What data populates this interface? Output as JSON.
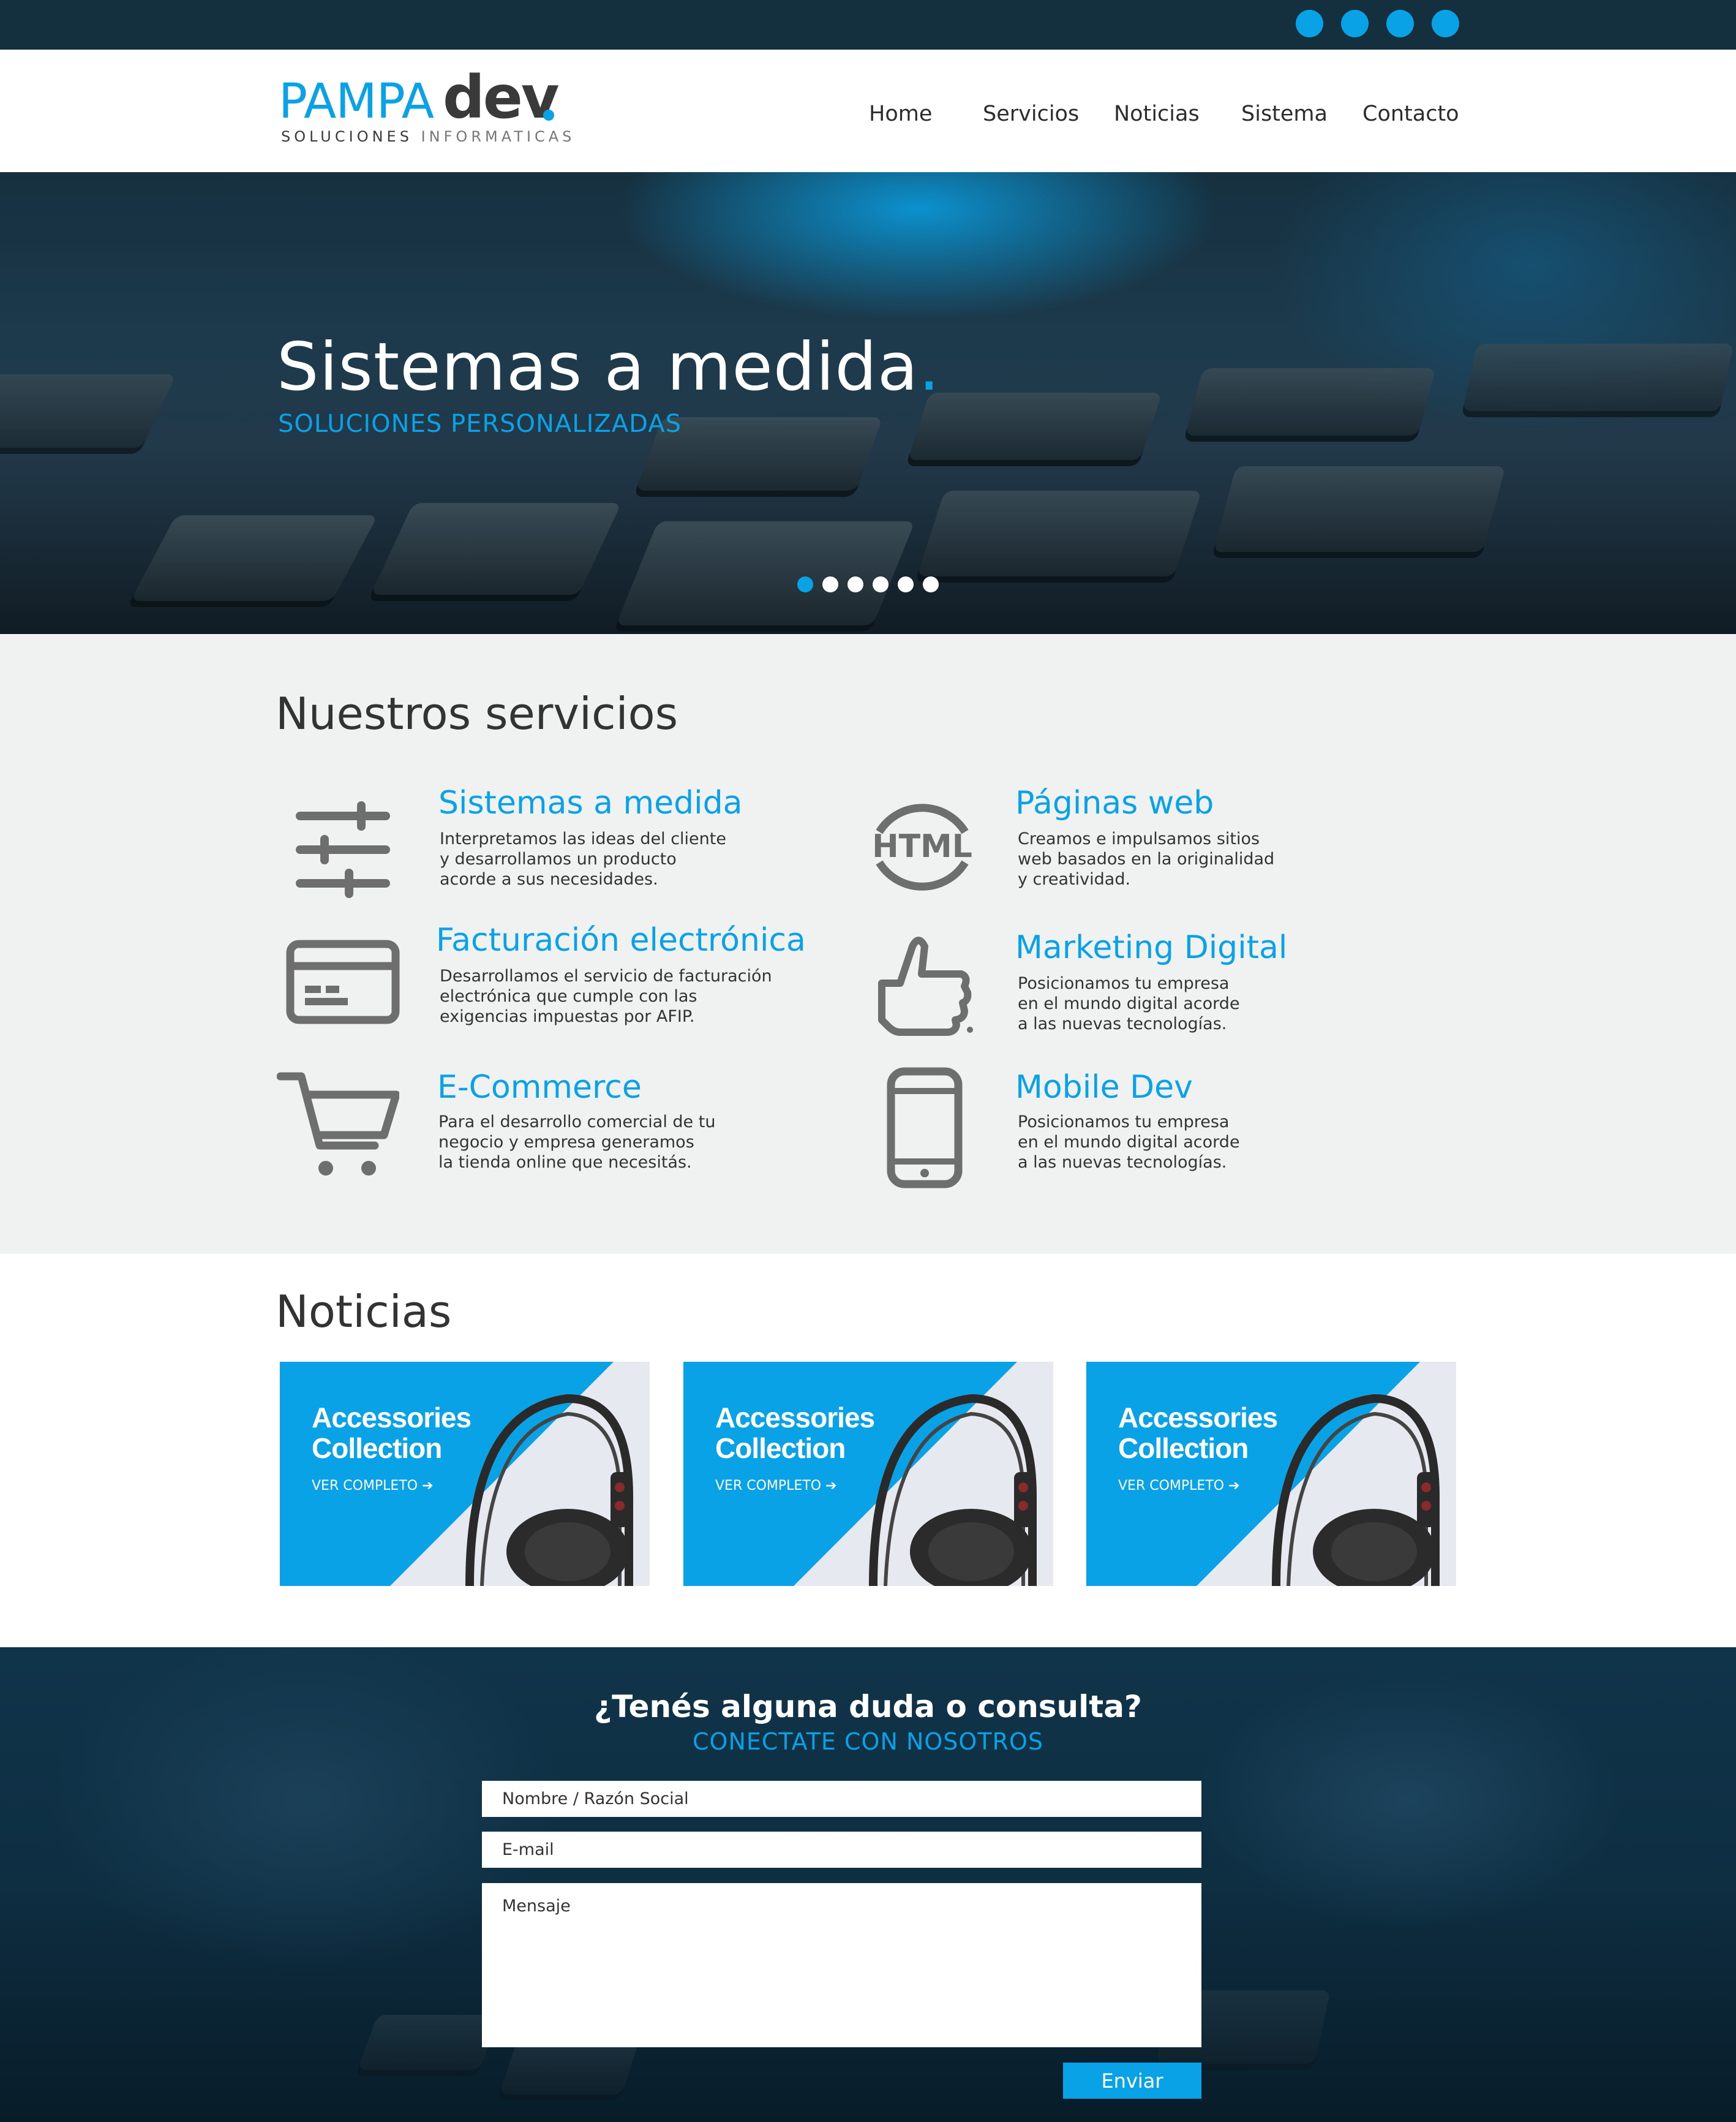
{
  "topbar": {
    "social": [
      {
        "icon": "social-icon-1",
        "color": "#0aa2e6"
      },
      {
        "icon": "social-icon-2",
        "color": "#0aa2e6"
      },
      {
        "icon": "social-icon-3",
        "color": "#0aa2e6"
      },
      {
        "icon": "social-icon-4",
        "color": "#0aa2e6"
      }
    ]
  },
  "header": {
    "logo": {
      "pampa": "PAMPA",
      "dev": "dev",
      "sub_dark": "SOLUCIONES",
      "sub_light": "INFORMATICAS"
    },
    "nav": [
      {
        "label": "Home"
      },
      {
        "label": "Servicios"
      },
      {
        "label": "Noticias"
      },
      {
        "label": "Sistema"
      },
      {
        "label": "Contacto"
      }
    ]
  },
  "hero": {
    "title": "Sistemas a medida",
    "title_dot": ".",
    "subtitle": "SOLUCIONES PERSONALIZADAS",
    "slides_total": 6,
    "active_slide": 1
  },
  "services": {
    "title": "Nuestros servicios",
    "items": [
      {
        "title": "Sistemas a medida",
        "desc": "Interpretamos las ideas del cliente\ny desarrollamos un producto\nacorde a sus necesidades.",
        "icon": "sliders-icon"
      },
      {
        "title": "Páginas web",
        "desc": "Creamos e impulsamos sitios\nweb basados en la originalidad\ny creatividad.",
        "icon": "html-icon",
        "icon_text": "HTML"
      },
      {
        "title": "Facturación electrónica",
        "desc": "Desarrollamos el servicio de facturación\nelectrónica que cumple con las\nexigencias impuestas por AFIP.",
        "icon": "credit-card-icon"
      },
      {
        "title": "Marketing Digital",
        "desc": "Posicionamos tu empresa\nen el mundo digital acorde\na las nuevas tecnologías.",
        "icon": "thumbs-up-icon"
      },
      {
        "title": "E-Commerce",
        "desc": "Para el desarrollo comercial de tu\nnegocio y empresa generamos\nla tienda online que necesitás.",
        "icon": "shopping-cart-icon"
      },
      {
        "title": "Mobile Dev",
        "desc": "Posicionamos tu empresa\nen el mundo digital acorde\na las nuevas tecnologías.",
        "icon": "smartphone-icon"
      }
    ]
  },
  "news": {
    "title": "Noticias",
    "cards": [
      {
        "title": "Accessories\nCollection",
        "link": "VER COMPLETO"
      },
      {
        "title": "Accessories\nCollection",
        "link": "VER COMPLETO"
      },
      {
        "title": "Accessories\nCollection",
        "link": "VER COMPLETO"
      }
    ]
  },
  "contact": {
    "title": "¿Tenés alguna duda o consulta?",
    "subtitle": "CONECTATE CON NOSOTROS",
    "name_placeholder": "Nombre / Razón Social",
    "email_placeholder": "E-mail",
    "message_placeholder": "Mensaje",
    "send_label": "Enviar"
  },
  "colors": {
    "accent": "#0aa2e6",
    "dark": "#14303e",
    "icon_gray": "#6e6e6e",
    "services_bg": "#f0f1f1"
  }
}
